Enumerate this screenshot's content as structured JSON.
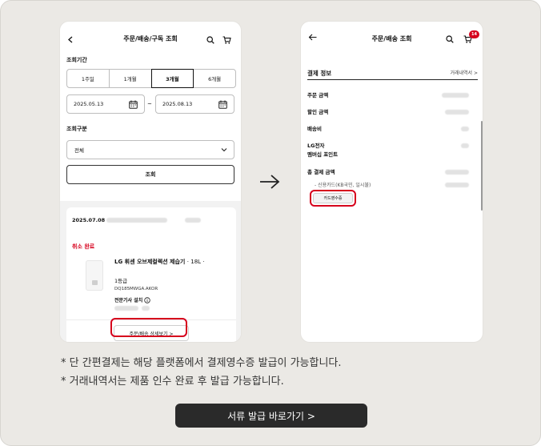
{
  "left_screen": {
    "header": {
      "title": "주문/배송/구독 조회",
      "back_icon": "chevron-left-icon",
      "search_icon": "search-icon",
      "cart_icon": "cart-icon"
    },
    "period_label": "조회기간",
    "periods": [
      "1주일",
      "1개월",
      "3개월",
      "6개월"
    ],
    "active_period": "3개월",
    "date_from": "2025.05.13",
    "date_to": "2025.08.13",
    "date_separator": "~",
    "category_label": "조회구분",
    "category_value": "전체",
    "search_button": "조회",
    "order": {
      "date": "2025.07.08",
      "status": "취소 완료",
      "product_name": "LG 휘센 오브제컬렉션 제습기",
      "product_option": "· 18L ·",
      "product_grade": "1등급",
      "model": "DQ185MWGA.AKOR",
      "install": "전문기사 설치",
      "detail_button": "주문/배송 상세보기 >"
    }
  },
  "right_screen": {
    "header": {
      "title": "주문/배송 조회",
      "back_icon": "arrow-left-icon",
      "search_icon": "search-icon",
      "cart_icon": "cart-icon",
      "cart_badge": "14"
    },
    "section_title": "결제 정보",
    "section_link": "거래내역서 >",
    "rows": [
      "주문 금액",
      "할인 금액",
      "배송비",
      "LG전자 멤버십 포인트",
      "총 결제 금액"
    ],
    "membership_line1": "LG전자",
    "membership_line2": "멤버십 포인트",
    "payment_method": "- 신용카드(KB국민, 일시불)",
    "receipt_button": "카드영수증"
  },
  "notes": [
    "* 단 간편결제는 해당 플랫폼에서 결제영수증 발급이 가능합니다.",
    "* 거래내역서는 제품 인수 완료 후 발급 가능합니다."
  ],
  "cta_button": "서류 발급 바로가기 >",
  "colors": {
    "accent_red": "#d6001c",
    "cta_bg": "#2a2a2a",
    "panel_bg": "#ebe9e5"
  }
}
